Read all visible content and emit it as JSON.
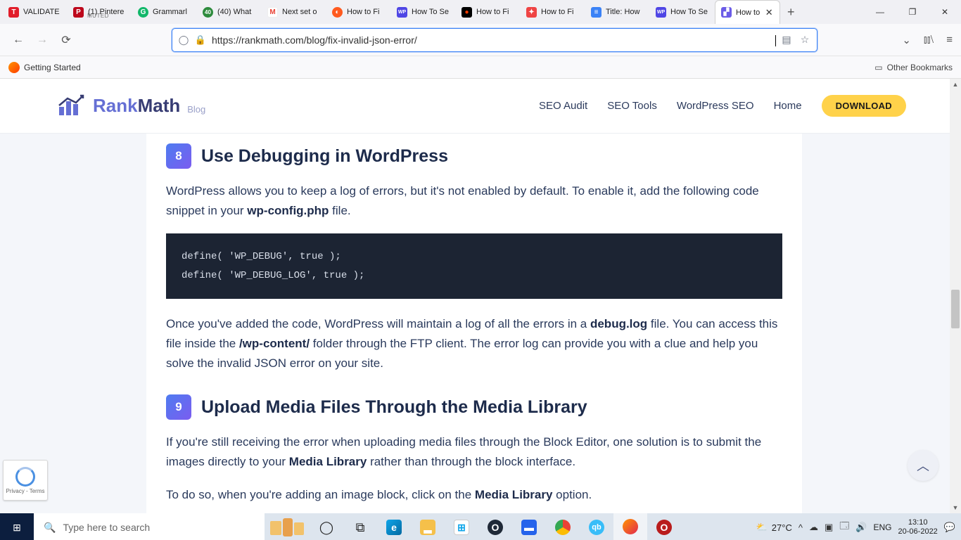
{
  "tabs": [
    {
      "fav_bg": "#e11d2a",
      "fav_txt": "T",
      "label": "VALIDATE"
    },
    {
      "fav_bg": "#bd081c",
      "fav_txt": "P",
      "label": "(1) Pintere",
      "muted": "MUTED"
    },
    {
      "fav_bg": "#12b76a",
      "fav_txt": "G",
      "label": "Grammarl"
    },
    {
      "fav_bg": "#2e8b3d",
      "fav_txt": "40",
      "label": "(40) What"
    },
    {
      "fav_bg": "#ffffff",
      "fav_txt": "M",
      "label": "Next set o",
      "fav_color": "#e94235"
    },
    {
      "fav_bg": "#ff5a1f",
      "fav_txt": "◐",
      "label": "How to Fi"
    },
    {
      "fav_bg": "#4f46e5",
      "fav_txt": "WP",
      "label": "How To Se"
    },
    {
      "fav_bg": "#000000",
      "fav_txt": "●",
      "label": "How to Fi",
      "fav_color": "#ff3b00"
    },
    {
      "fav_bg": "#ef4444",
      "fav_txt": "✦",
      "label": "How to Fi"
    },
    {
      "fav_bg": "#3b82f6",
      "fav_txt": "≡",
      "label": "Title: How"
    },
    {
      "fav_bg": "#4f46e5",
      "fav_txt": "WP",
      "label": "How To Se"
    },
    {
      "fav_bg": "#6b5ce7",
      "fav_txt": "▞",
      "label": "How to",
      "active": true
    }
  ],
  "window": {
    "min": "—",
    "max": "❐",
    "close": "✕",
    "newtab": "+"
  },
  "toolbar": {
    "url": "https://rankmath.com/blog/fix-invalid-json-error/",
    "getting_started": "Getting Started",
    "other_bookmarks": "Other Bookmarks"
  },
  "site": {
    "brand_a": "Rank",
    "brand_b": "Math",
    "sub": "Blog",
    "nav": [
      "SEO Audit",
      "SEO Tools",
      "WordPress SEO",
      "Home"
    ],
    "download": "DOWNLOAD"
  },
  "article": {
    "sec8_num": "8",
    "sec8_title": "Use Debugging in WordPress",
    "p1_a": "WordPress allows you to keep a log of errors, but it's not enabled by default. To enable it, add the following code snippet in your ",
    "p1_b": "wp-config.php",
    "p1_c": " file.",
    "code": "define( 'WP_DEBUG', true );\ndefine( 'WP_DEBUG_LOG', true );",
    "p2_a": "Once you've added the code, WordPress will maintain a log of all the errors in a ",
    "p2_b": "debug.log",
    "p2_c": " file. You can access this file inside the ",
    "p2_d": "/wp-content/",
    "p2_e": " folder through the FTP client. The error log can provide you with a clue and help you solve the invalid JSON error on your site.",
    "sec9_num": "9",
    "sec9_title": "Upload Media Files Through the Media Library",
    "p3_a": "If you're still receiving the error when uploading media files through the Block Editor, one solution is to submit the images directly to your ",
    "p3_b": "Media Library",
    "p3_c": " rather than through the block interface.",
    "p4_a": "To do so, when you're adding an image block, click on the ",
    "p4_b": "Media Library",
    "p4_c": " option."
  },
  "recaptcha": {
    "label": "Privacy - Terms"
  },
  "taskbar": {
    "search_placeholder": "Type here to search",
    "weather": "27°C",
    "lang": "ENG",
    "time": "13:10",
    "date": "20-06-2022"
  }
}
